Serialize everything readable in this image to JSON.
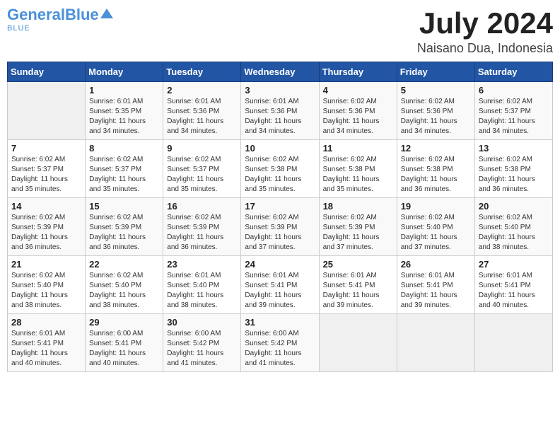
{
  "header": {
    "logo_general": "General",
    "logo_blue": "Blue",
    "month_year": "July 2024",
    "location": "Naisano Dua, Indonesia"
  },
  "weekdays": [
    "Sunday",
    "Monday",
    "Tuesday",
    "Wednesday",
    "Thursday",
    "Friday",
    "Saturday"
  ],
  "weeks": [
    [
      {
        "day": "",
        "sunrise": "",
        "sunset": "",
        "daylight": ""
      },
      {
        "day": "1",
        "sunrise": "Sunrise: 6:01 AM",
        "sunset": "Sunset: 5:35 PM",
        "daylight": "Daylight: 11 hours and 34 minutes."
      },
      {
        "day": "2",
        "sunrise": "Sunrise: 6:01 AM",
        "sunset": "Sunset: 5:36 PM",
        "daylight": "Daylight: 11 hours and 34 minutes."
      },
      {
        "day": "3",
        "sunrise": "Sunrise: 6:01 AM",
        "sunset": "Sunset: 5:36 PM",
        "daylight": "Daylight: 11 hours and 34 minutes."
      },
      {
        "day": "4",
        "sunrise": "Sunrise: 6:02 AM",
        "sunset": "Sunset: 5:36 PM",
        "daylight": "Daylight: 11 hours and 34 minutes."
      },
      {
        "day": "5",
        "sunrise": "Sunrise: 6:02 AM",
        "sunset": "Sunset: 5:36 PM",
        "daylight": "Daylight: 11 hours and 34 minutes."
      },
      {
        "day": "6",
        "sunrise": "Sunrise: 6:02 AM",
        "sunset": "Sunset: 5:37 PM",
        "daylight": "Daylight: 11 hours and 34 minutes."
      }
    ],
    [
      {
        "day": "7",
        "sunrise": "Sunrise: 6:02 AM",
        "sunset": "Sunset: 5:37 PM",
        "daylight": "Daylight: 11 hours and 35 minutes."
      },
      {
        "day": "8",
        "sunrise": "Sunrise: 6:02 AM",
        "sunset": "Sunset: 5:37 PM",
        "daylight": "Daylight: 11 hours and 35 minutes."
      },
      {
        "day": "9",
        "sunrise": "Sunrise: 6:02 AM",
        "sunset": "Sunset: 5:37 PM",
        "daylight": "Daylight: 11 hours and 35 minutes."
      },
      {
        "day": "10",
        "sunrise": "Sunrise: 6:02 AM",
        "sunset": "Sunset: 5:38 PM",
        "daylight": "Daylight: 11 hours and 35 minutes."
      },
      {
        "day": "11",
        "sunrise": "Sunrise: 6:02 AM",
        "sunset": "Sunset: 5:38 PM",
        "daylight": "Daylight: 11 hours and 35 minutes."
      },
      {
        "day": "12",
        "sunrise": "Sunrise: 6:02 AM",
        "sunset": "Sunset: 5:38 PM",
        "daylight": "Daylight: 11 hours and 36 minutes."
      },
      {
        "day": "13",
        "sunrise": "Sunrise: 6:02 AM",
        "sunset": "Sunset: 5:38 PM",
        "daylight": "Daylight: 11 hours and 36 minutes."
      }
    ],
    [
      {
        "day": "14",
        "sunrise": "Sunrise: 6:02 AM",
        "sunset": "Sunset: 5:39 PM",
        "daylight": "Daylight: 11 hours and 36 minutes."
      },
      {
        "day": "15",
        "sunrise": "Sunrise: 6:02 AM",
        "sunset": "Sunset: 5:39 PM",
        "daylight": "Daylight: 11 hours and 36 minutes."
      },
      {
        "day": "16",
        "sunrise": "Sunrise: 6:02 AM",
        "sunset": "Sunset: 5:39 PM",
        "daylight": "Daylight: 11 hours and 36 minutes."
      },
      {
        "day": "17",
        "sunrise": "Sunrise: 6:02 AM",
        "sunset": "Sunset: 5:39 PM",
        "daylight": "Daylight: 11 hours and 37 minutes."
      },
      {
        "day": "18",
        "sunrise": "Sunrise: 6:02 AM",
        "sunset": "Sunset: 5:39 PM",
        "daylight": "Daylight: 11 hours and 37 minutes."
      },
      {
        "day": "19",
        "sunrise": "Sunrise: 6:02 AM",
        "sunset": "Sunset: 5:40 PM",
        "daylight": "Daylight: 11 hours and 37 minutes."
      },
      {
        "day": "20",
        "sunrise": "Sunrise: 6:02 AM",
        "sunset": "Sunset: 5:40 PM",
        "daylight": "Daylight: 11 hours and 38 minutes."
      }
    ],
    [
      {
        "day": "21",
        "sunrise": "Sunrise: 6:02 AM",
        "sunset": "Sunset: 5:40 PM",
        "daylight": "Daylight: 11 hours and 38 minutes."
      },
      {
        "day": "22",
        "sunrise": "Sunrise: 6:02 AM",
        "sunset": "Sunset: 5:40 PM",
        "daylight": "Daylight: 11 hours and 38 minutes."
      },
      {
        "day": "23",
        "sunrise": "Sunrise: 6:01 AM",
        "sunset": "Sunset: 5:40 PM",
        "daylight": "Daylight: 11 hours and 38 minutes."
      },
      {
        "day": "24",
        "sunrise": "Sunrise: 6:01 AM",
        "sunset": "Sunset: 5:41 PM",
        "daylight": "Daylight: 11 hours and 39 minutes."
      },
      {
        "day": "25",
        "sunrise": "Sunrise: 6:01 AM",
        "sunset": "Sunset: 5:41 PM",
        "daylight": "Daylight: 11 hours and 39 minutes."
      },
      {
        "day": "26",
        "sunrise": "Sunrise: 6:01 AM",
        "sunset": "Sunset: 5:41 PM",
        "daylight": "Daylight: 11 hours and 39 minutes."
      },
      {
        "day": "27",
        "sunrise": "Sunrise: 6:01 AM",
        "sunset": "Sunset: 5:41 PM",
        "daylight": "Daylight: 11 hours and 40 minutes."
      }
    ],
    [
      {
        "day": "28",
        "sunrise": "Sunrise: 6:01 AM",
        "sunset": "Sunset: 5:41 PM",
        "daylight": "Daylight: 11 hours and 40 minutes."
      },
      {
        "day": "29",
        "sunrise": "Sunrise: 6:00 AM",
        "sunset": "Sunset: 5:41 PM",
        "daylight": "Daylight: 11 hours and 40 minutes."
      },
      {
        "day": "30",
        "sunrise": "Sunrise: 6:00 AM",
        "sunset": "Sunset: 5:42 PM",
        "daylight": "Daylight: 11 hours and 41 minutes."
      },
      {
        "day": "31",
        "sunrise": "Sunrise: 6:00 AM",
        "sunset": "Sunset: 5:42 PM",
        "daylight": "Daylight: 11 hours and 41 minutes."
      },
      {
        "day": "",
        "sunrise": "",
        "sunset": "",
        "daylight": ""
      },
      {
        "day": "",
        "sunrise": "",
        "sunset": "",
        "daylight": ""
      },
      {
        "day": "",
        "sunrise": "",
        "sunset": "",
        "daylight": ""
      }
    ]
  ]
}
